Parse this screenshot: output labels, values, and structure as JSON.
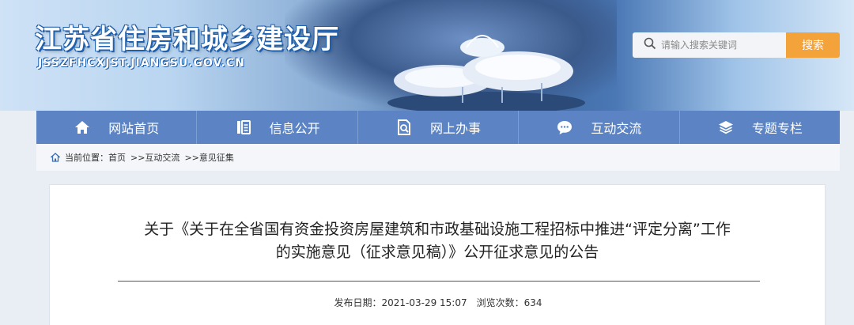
{
  "header": {
    "site_title": "江苏省住房和城乡建设厅",
    "site_domain": "JSSZFHCXJST.JIANGSU.GOV.CN",
    "search_placeholder": "请输入搜索关键词",
    "search_button": "搜索"
  },
  "nav": {
    "items": [
      {
        "label": "网站首页",
        "icon": "home-icon"
      },
      {
        "label": "信息公开",
        "icon": "info-list-icon"
      },
      {
        "label": "网上办事",
        "icon": "document-search-icon"
      },
      {
        "label": "互动交流",
        "icon": "chat-bubble-icon"
      },
      {
        "label": "专题专栏",
        "icon": "layers-icon"
      }
    ]
  },
  "breadcrumb": {
    "prefix": "当前位置：",
    "items": [
      "首页",
      ">>互动交流",
      ">>意见征集"
    ]
  },
  "article": {
    "title": "关于《关于在全省国有资金投资房屋建筑和市政基础设施工程招标中推进“评定分离”工作的实施意见（征求意见稿）》公开征求意见的公告",
    "publish_label": "发布日期：",
    "publish_date": "2021-03-29 15:07",
    "views_label": "浏览次数：",
    "views": "634"
  },
  "colors": {
    "nav_bg": "#5c84c4",
    "search_button": "#f4a23a",
    "title_outline": "#1e5fae",
    "page_bg": "#e9eef5"
  }
}
